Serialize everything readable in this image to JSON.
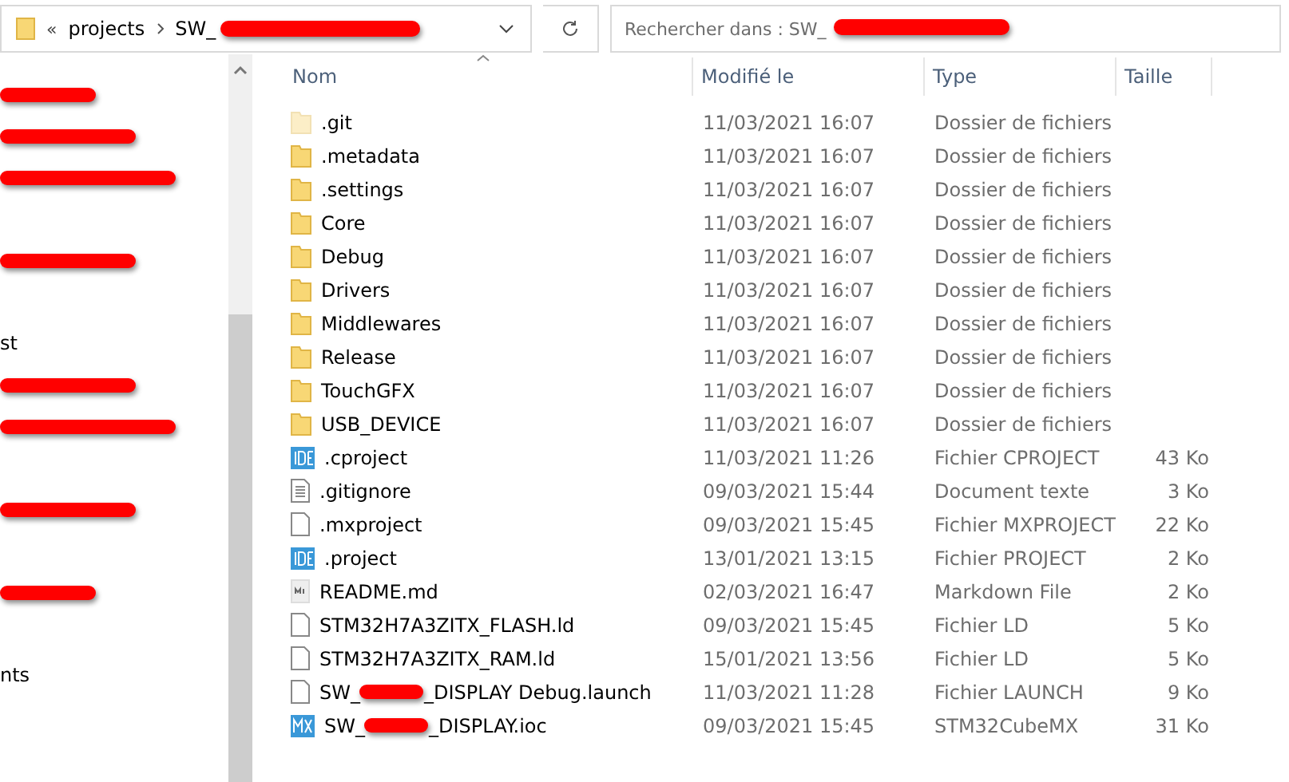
{
  "address_bar": {
    "overflow": "«",
    "crumbs": [
      "projects",
      "SW_"
    ]
  },
  "search": {
    "placeholder": "Rechercher dans : SW_"
  },
  "sidebar": {
    "items": [
      {
        "kind": "redacted"
      },
      {
        "kind": "redacted"
      },
      {
        "kind": "redacted"
      },
      {
        "kind": "gap"
      },
      {
        "kind": "redacted"
      },
      {
        "kind": "gap"
      },
      {
        "kind": "text",
        "label": "st"
      },
      {
        "kind": "redacted"
      },
      {
        "kind": "redacted"
      },
      {
        "kind": "gap"
      },
      {
        "kind": "redacted"
      },
      {
        "kind": "gap"
      },
      {
        "kind": "redacted"
      },
      {
        "kind": "gap"
      },
      {
        "kind": "text",
        "label": "nts"
      }
    ]
  },
  "table": {
    "columns": [
      "Nom",
      "Modifié le",
      "Type",
      "Taille"
    ],
    "rows": [
      {
        "kind": "folder",
        "hidden": true,
        "name": [
          ".git"
        ],
        "modified": "11/03/2021 16:07",
        "type": "Dossier de fichiers"
      },
      {
        "kind": "folder",
        "hidden": false,
        "name": [
          ".metadata"
        ],
        "modified": "11/03/2021 16:07",
        "type": "Dossier de fichiers"
      },
      {
        "kind": "folder",
        "hidden": false,
        "name": [
          ".settings"
        ],
        "modified": "11/03/2021 16:07",
        "type": "Dossier de fichiers"
      },
      {
        "kind": "folder",
        "hidden": false,
        "name": [
          "Core"
        ],
        "modified": "11/03/2021 16:07",
        "type": "Dossier de fichiers"
      },
      {
        "kind": "folder",
        "hidden": false,
        "name": [
          "Debug"
        ],
        "modified": "11/03/2021 16:07",
        "type": "Dossier de fichiers"
      },
      {
        "kind": "folder",
        "hidden": false,
        "name": [
          "Drivers"
        ],
        "modified": "11/03/2021 16:07",
        "type": "Dossier de fichiers"
      },
      {
        "kind": "folder",
        "hidden": false,
        "name": [
          "Middlewares"
        ],
        "modified": "11/03/2021 16:07",
        "type": "Dossier de fichiers"
      },
      {
        "kind": "folder",
        "hidden": false,
        "name": [
          "Release"
        ],
        "modified": "11/03/2021 16:07",
        "type": "Dossier de fichiers"
      },
      {
        "kind": "folder",
        "hidden": false,
        "name": [
          "TouchGFX"
        ],
        "modified": "11/03/2021 16:07",
        "type": "Dossier de fichiers"
      },
      {
        "kind": "folder",
        "hidden": false,
        "name": [
          "USB_DEVICE"
        ],
        "modified": "11/03/2021 16:07",
        "type": "Dossier de fichiers"
      },
      {
        "kind": "ide",
        "hidden": false,
        "name": [
          ".cproject"
        ],
        "modified": "11/03/2021 11:26",
        "type": "Fichier CPROJECT",
        "size": "43 Ko"
      },
      {
        "kind": "text",
        "hidden": false,
        "name": [
          ".gitignore"
        ],
        "modified": "09/03/2021 15:44",
        "type": "Document texte",
        "size": "3 Ko"
      },
      {
        "kind": "file",
        "hidden": false,
        "name": [
          ".mxproject"
        ],
        "modified": "09/03/2021 15:45",
        "type": "Fichier MXPROJECT",
        "size": "22 Ko"
      },
      {
        "kind": "ide",
        "hidden": false,
        "name": [
          ".project"
        ],
        "modified": "13/01/2021 13:15",
        "type": "Fichier PROJECT",
        "size": "2 Ko"
      },
      {
        "kind": "md",
        "hidden": false,
        "name": [
          "README.md"
        ],
        "modified": "02/03/2021 16:47",
        "type": "Markdown File",
        "size": "2 Ko"
      },
      {
        "kind": "file",
        "hidden": false,
        "name": [
          "STM32H7A3ZITX_FLASH.ld"
        ],
        "modified": "09/03/2021 15:45",
        "type": "Fichier LD",
        "size": "5 Ko"
      },
      {
        "kind": "file",
        "hidden": false,
        "name": [
          "STM32H7A3ZITX_RAM.ld"
        ],
        "modified": "15/01/2021 13:56",
        "type": "Fichier LD",
        "size": "5 Ko"
      },
      {
        "kind": "file",
        "hidden": false,
        "name": [
          "SW_",
          "_DISPLAY Debug.launch"
        ],
        "modified": "11/03/2021 11:28",
        "type": "Fichier LAUNCH",
        "size": "9 Ko"
      },
      {
        "kind": "mx",
        "hidden": false,
        "name": [
          "SW_",
          "_DISPLAY.ioc"
        ],
        "modified": "09/03/2021 15:45",
        "type": "STM32CubeMX",
        "size": "31 Ko"
      }
    ]
  }
}
